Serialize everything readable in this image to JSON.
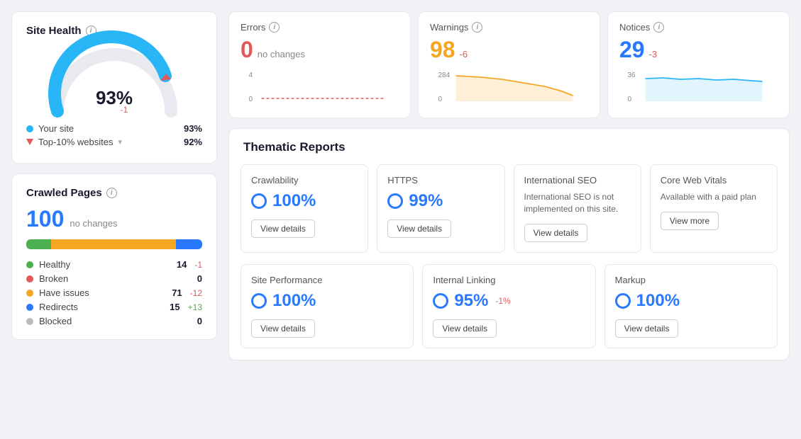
{
  "siteHealth": {
    "title": "Site Health",
    "percent": "93%",
    "delta": "-1",
    "yourSite": {
      "label": "Your site",
      "value": "93%",
      "color": "#29b6f6"
    },
    "topSites": {
      "label": "Top-10% websites",
      "value": "92%",
      "color": "#e05a5a"
    }
  },
  "crawledPages": {
    "title": "Crawled Pages",
    "count": "100",
    "sub": "no changes",
    "items": [
      {
        "label": "Healthy",
        "color": "#4caf50",
        "count": "14",
        "delta": "-1",
        "deltaType": "neg"
      },
      {
        "label": "Broken",
        "color": "#e05a5a",
        "count": "0",
        "delta": "",
        "deltaType": ""
      },
      {
        "label": "Have issues",
        "color": "#f5a623",
        "count": "71",
        "delta": "-12",
        "deltaType": "neg"
      },
      {
        "label": "Redirects",
        "color": "#2979ff",
        "count": "15",
        "delta": "+13",
        "deltaType": "pos"
      },
      {
        "label": "Blocked",
        "color": "#bbb",
        "count": "0",
        "delta": "",
        "deltaType": ""
      }
    ],
    "progressSegments": [
      {
        "color": "#4caf50",
        "pct": 14
      },
      {
        "color": "#f5a623",
        "pct": 71
      },
      {
        "color": "#2979ff",
        "pct": 15
      }
    ]
  },
  "metrics": {
    "errors": {
      "title": "Errors",
      "value": "0",
      "sub": "no changes",
      "delta": "",
      "deltaType": "",
      "yMax": "4",
      "yMin": "0",
      "sparkColor": "#e05a5a",
      "sparkFill": "none"
    },
    "warnings": {
      "title": "Warnings",
      "value": "98",
      "delta": "-6",
      "deltaType": "neg",
      "yMax": "284",
      "yMin": "0",
      "sparkColor": "#f5a623",
      "sparkFill": "#fde8c8"
    },
    "notices": {
      "title": "Notices",
      "value": "29",
      "delta": "-3",
      "deltaType": "neg",
      "yMax": "36",
      "yMin": "0",
      "sparkColor": "#29b6f6",
      "sparkFill": "#d6f0fb"
    }
  },
  "thematic": {
    "title": "Thematic Reports",
    "topCards": [
      {
        "title": "Crawlability",
        "score": "100%",
        "delta": "",
        "showBtn": true,
        "btnLabel": "View details",
        "text": ""
      },
      {
        "title": "HTTPS",
        "score": "99%",
        "delta": "",
        "showBtn": true,
        "btnLabel": "View details",
        "text": ""
      },
      {
        "title": "International SEO",
        "score": "",
        "delta": "",
        "showBtn": true,
        "btnLabel": "View details",
        "text": "International SEO is not implemented on this site."
      },
      {
        "title": "Core Web Vitals",
        "score": "",
        "delta": "",
        "showBtn": true,
        "btnLabel": "View more",
        "text": "Available with a paid plan"
      }
    ],
    "bottomCards": [
      {
        "title": "Site Performance",
        "score": "100%",
        "delta": "",
        "showBtn": true,
        "btnLabel": "View details",
        "text": ""
      },
      {
        "title": "Internal Linking",
        "score": "95%",
        "delta": "-1%",
        "showBtn": true,
        "btnLabel": "View details",
        "text": ""
      },
      {
        "title": "Markup",
        "score": "100%",
        "delta": "",
        "showBtn": true,
        "btnLabel": "View details",
        "text": ""
      }
    ]
  },
  "icons": {
    "info": "i",
    "dropdown": "▾"
  }
}
